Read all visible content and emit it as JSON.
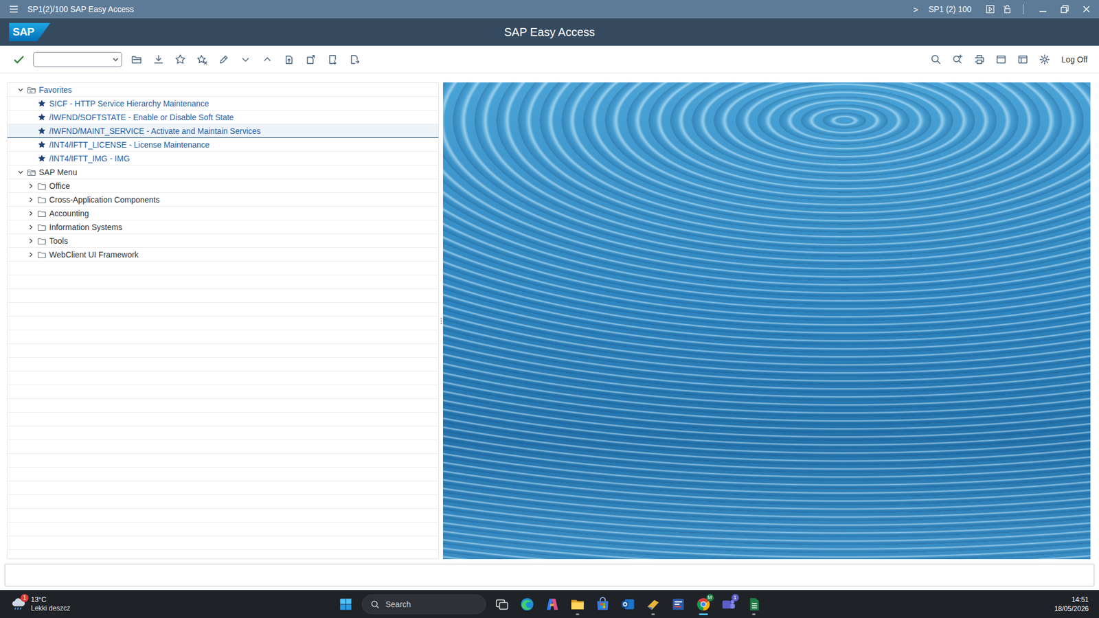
{
  "window": {
    "title": "SP1(2)/100 SAP Easy Access",
    "chevron": ">",
    "system": "SP1 (2) 100"
  },
  "header": {
    "logo": "SAP",
    "title": "SAP Easy Access"
  },
  "toolbar": {
    "log_off": "Log Off"
  },
  "tree": [
    {
      "label": "Favorites",
      "kind": "root",
      "level": 0,
      "expanded": true,
      "selected": false,
      "color": "#1f5fa8"
    },
    {
      "label": "SICF - HTTP Service Hierarchy Maintenance",
      "kind": "favorite",
      "level": 1,
      "selected": false,
      "color": "#1f5fa8"
    },
    {
      "label": "/IWFND/SOFTSTATE - Enable or Disable Soft State",
      "kind": "favorite",
      "level": 1,
      "selected": false,
      "color": "#1f5fa8"
    },
    {
      "label": "/IWFND/MAINT_SERVICE - Activate and Maintain Services",
      "kind": "favorite",
      "level": 1,
      "selected": true,
      "color": "#1f5fa8"
    },
    {
      "label": "/INT4/IFTT_LICENSE - License Maintenance",
      "kind": "favorite",
      "level": 1,
      "selected": false,
      "color": "#1f5fa8"
    },
    {
      "label": "/INT4/IFTT_IMG - IMG",
      "kind": "favorite",
      "level": 1,
      "selected": false,
      "color": "#1f5fa8"
    },
    {
      "label": "SAP Menu",
      "kind": "root",
      "level": 0,
      "expanded": true,
      "selected": false,
      "color": "#32363a"
    },
    {
      "label": "Office",
      "kind": "folder",
      "level": 1,
      "expanded": false,
      "selected": false,
      "color": "#32363a"
    },
    {
      "label": "Cross-Application Components",
      "kind": "folder",
      "level": 1,
      "expanded": false,
      "selected": false,
      "color": "#32363a"
    },
    {
      "label": "Accounting",
      "kind": "folder",
      "level": 1,
      "expanded": false,
      "selected": false,
      "color": "#32363a"
    },
    {
      "label": "Information Systems",
      "kind": "folder",
      "level": 1,
      "expanded": false,
      "selected": false,
      "color": "#32363a"
    },
    {
      "label": "Tools",
      "kind": "folder",
      "level": 1,
      "expanded": false,
      "selected": false,
      "color": "#32363a"
    },
    {
      "label": "WebClient UI Framework",
      "kind": "folder",
      "level": 1,
      "expanded": false,
      "selected": false,
      "color": "#32363a"
    }
  ],
  "taskbar": {
    "weather": {
      "temp": "13°C",
      "text": "Lekki deszcz",
      "badge": "1"
    },
    "search": "Search",
    "apps": [
      {
        "kind": "task-view",
        "running": false,
        "active": false
      },
      {
        "kind": "edge",
        "running": false,
        "active": false
      },
      {
        "kind": "copilot",
        "running": false,
        "active": false
      },
      {
        "kind": "explorer",
        "running": true,
        "active": false
      },
      {
        "kind": "store",
        "running": false,
        "active": false
      },
      {
        "kind": "outlook",
        "running": false,
        "active": false
      },
      {
        "kind": "sap-logon",
        "running": true,
        "active": false
      },
      {
        "kind": "sap-gui",
        "running": false,
        "active": false
      },
      {
        "kind": "chrome",
        "running": true,
        "active": true,
        "badge": "M"
      },
      {
        "kind": "teams",
        "running": false,
        "active": false,
        "badge": "1"
      },
      {
        "kind": "sheets",
        "running": true,
        "active": false
      }
    ],
    "time": "14:51",
    "date": "18/05/2026"
  }
}
